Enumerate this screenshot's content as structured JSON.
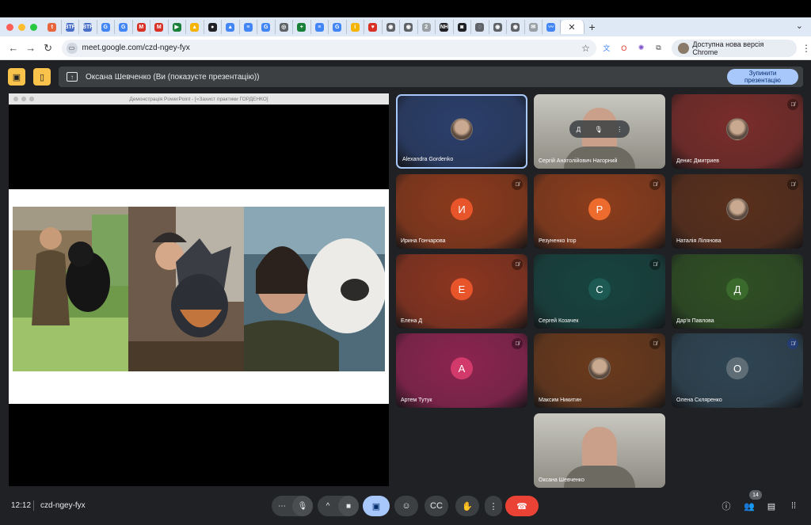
{
  "browser": {
    "tabs": [
      {
        "label": "t",
        "color": "#e8663d"
      },
      {
        "label": "BTF",
        "color": "#4a6fc7"
      },
      {
        "label": "BTF",
        "color": "#4a6fc7"
      },
      {
        "label": "G",
        "color": "#4285f4"
      },
      {
        "label": "G",
        "color": "#4285f4"
      },
      {
        "label": "M",
        "color": "#d93025"
      },
      {
        "label": "M",
        "color": "#d93025"
      },
      {
        "label": "▶",
        "color": "#188038"
      },
      {
        "label": "▲",
        "color": "#f4b400"
      },
      {
        "label": "●",
        "color": "#202124"
      },
      {
        "label": "▲",
        "color": "#4285f4"
      },
      {
        "label": "≡",
        "color": "#4285f4"
      },
      {
        "label": "G",
        "color": "#4285f4"
      },
      {
        "label": "◎",
        "color": "#5f6368"
      },
      {
        "label": "+",
        "color": "#188038"
      },
      {
        "label": "≡",
        "color": "#4285f4"
      },
      {
        "label": "G",
        "color": "#4285f4"
      },
      {
        "label": "i",
        "color": "#f4b400"
      },
      {
        "label": "♥",
        "color": "#d93025"
      },
      {
        "label": "◉",
        "color": "#5f6368"
      },
      {
        "label": "◉",
        "color": "#5f6368"
      },
      {
        "label": "2",
        "color": "#9aa0a6"
      },
      {
        "label": "NH",
        "color": "#202124"
      },
      {
        "label": "◙",
        "color": "#202124"
      },
      {
        "label": "◌",
        "color": "#5f6368"
      },
      {
        "label": "◉",
        "color": "#5f6368"
      },
      {
        "label": "◉",
        "color": "#5f6368"
      },
      {
        "label": "✉",
        "color": "#9aa0a6"
      },
      {
        "label": "〰",
        "color": "#4285f4"
      }
    ],
    "close_glyph": "✕",
    "new_tab_glyph": "+",
    "url": "meet.google.com/czd-ngey-fyx",
    "update_label": "Доступна нова версія Chrome"
  },
  "presenting_bar": {
    "label": "Оксана Шевченко (Ви (показуєте презентацію))",
    "stop_label_1": "Зупинити",
    "stop_label_2": "презентацію"
  },
  "presentation": {
    "window_title": "Демонстрація PowerPoint - [«Захист практики ГОРДЕНКО]"
  },
  "participants": [
    {
      "name": "Alexandra Gordenko",
      "initial": "",
      "bg": "#2b3f6b",
      "muted": false,
      "photo": true,
      "selected": true
    },
    {
      "name": "Сергій Анатолійович Нагорний",
      "initial": "",
      "bg": "#8a8a7a",
      "muted": false,
      "photo": false,
      "camera": true
    },
    {
      "name": "Денис Дмитриев",
      "initial": "",
      "bg": "#7a2d2a",
      "muted": true,
      "photo": true
    },
    {
      "name": "Ирина Гончарова",
      "initial": "И",
      "bg": "#8c3a1c",
      "avatar_color": "#e9552b",
      "muted": true
    },
    {
      "name": "Резуненко Ігор",
      "initial": "Р",
      "bg": "#8c3d1c",
      "avatar_color": "#ec6b2d",
      "muted": true
    },
    {
      "name": "Наталія Лілянова",
      "initial": "",
      "bg": "#5a2f1c",
      "muted": true,
      "photo": true
    },
    {
      "name": "Елена Д",
      "initial": "Е",
      "bg": "#8c3520",
      "avatar_color": "#e9552b",
      "muted": true
    },
    {
      "name": "Сергей Козачек",
      "initial": "С",
      "bg": "#17433f",
      "avatar_color": "#1c5a53",
      "muted": true
    },
    {
      "name": "Дар'я Павлова",
      "initial": "Д",
      "bg": "#2f4f24",
      "avatar_color": "#3a6b2c",
      "muted": false
    },
    {
      "name": "Артем Тутук",
      "initial": "А",
      "bg": "#8c2450",
      "avatar_color": "#d13a6a",
      "muted": true
    },
    {
      "name": "Максим Никитин",
      "initial": "",
      "bg": "#6b3a1c",
      "muted": true,
      "photo": true
    },
    {
      "name": "Олена Скляренко",
      "initial": "О",
      "bg": "#2f4553",
      "avatar_color": "#5f6d76",
      "muted": true,
      "blue_mute": true
    },
    {
      "name": "Оксана Шевченко",
      "initial": "",
      "bg": "#9b9a92",
      "muted": false,
      "camera": true
    }
  ],
  "hover_ctrl_initial": "Д",
  "bottom": {
    "time": "12:12",
    "meeting_code": "czd-ngey-fyx",
    "participant_count": "14"
  },
  "icons": {
    "mic": "mic-icon",
    "camera": "camera-icon",
    "present": "present-icon",
    "emoji": "emoji-icon",
    "captions": "captions-icon",
    "hand": "raise-hand-icon",
    "more": "more-icon",
    "end": "end-call-icon",
    "info": "info-icon",
    "people": "people-icon",
    "chat": "chat-icon",
    "activities": "activities-icon"
  },
  "colors": {
    "accent": "#a8c7fa",
    "end_call": "#ea4335",
    "warning": "#f9c24b"
  }
}
